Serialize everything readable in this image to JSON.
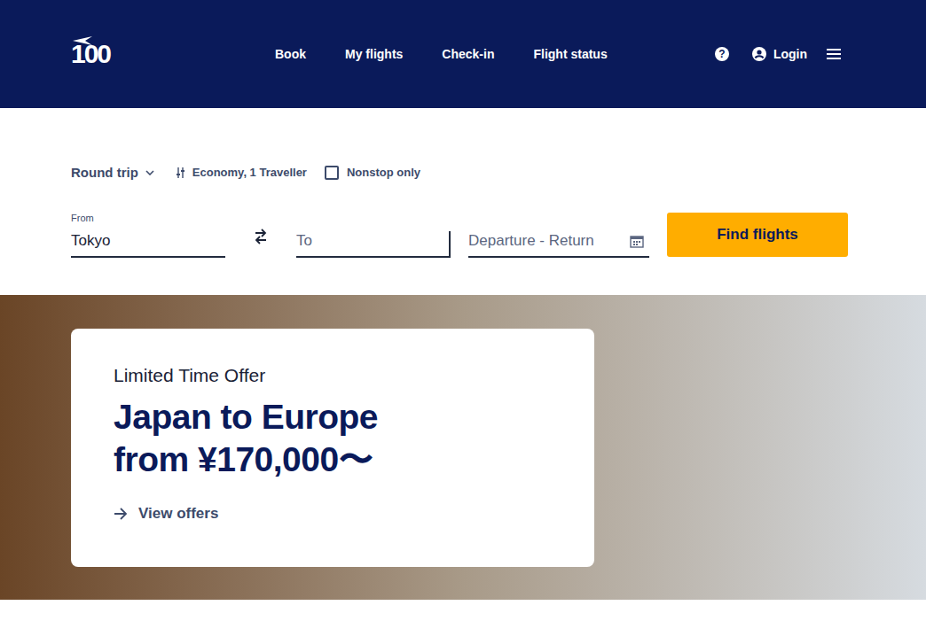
{
  "logo": {
    "text": "100"
  },
  "nav": [
    {
      "label": "Book"
    },
    {
      "label": "My flights"
    },
    {
      "label": "Check-in"
    },
    {
      "label": "Flight status"
    }
  ],
  "utility": {
    "help": "?",
    "login": "Login"
  },
  "search": {
    "trip_type": "Round trip",
    "cabin": "Economy, 1 Traveller",
    "nonstop": {
      "label": "Nonstop only",
      "checked": false
    },
    "from": {
      "label": "From",
      "value": "Tokyo"
    },
    "to": {
      "placeholder": "To"
    },
    "dates": {
      "placeholder": "Departure - Return"
    },
    "button": "Find flights"
  },
  "hero": {
    "eyebrow": "Limited Time Offer",
    "headline": [
      "Japan to Europe",
      "from ¥170,000〜"
    ],
    "link": "View offers"
  }
}
